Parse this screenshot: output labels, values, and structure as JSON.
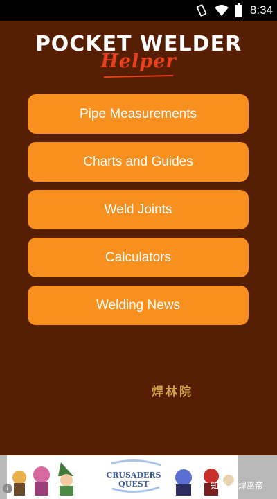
{
  "status_bar": {
    "time": "8:34",
    "icons": [
      "vibrate-icon",
      "wifi-icon",
      "battery-icon"
    ]
  },
  "logo": {
    "main_text": "POCKET WELDER",
    "script_text": "Helper"
  },
  "menu": {
    "items": [
      {
        "label": "Pipe Measurements"
      },
      {
        "label": "Charts and Guides"
      },
      {
        "label": "Weld Joints"
      },
      {
        "label": "Calculators"
      },
      {
        "label": "Welding News"
      }
    ]
  },
  "watermark": "焊林院",
  "ad": {
    "title": "CRUSADERS QUEST",
    "info_label": "i",
    "credit": "知乎 @焊巫帝"
  },
  "colors": {
    "background": "#561f04",
    "button": "#f7901f",
    "logo_script": "#e8411b",
    "watermark": "#d3a24f"
  }
}
